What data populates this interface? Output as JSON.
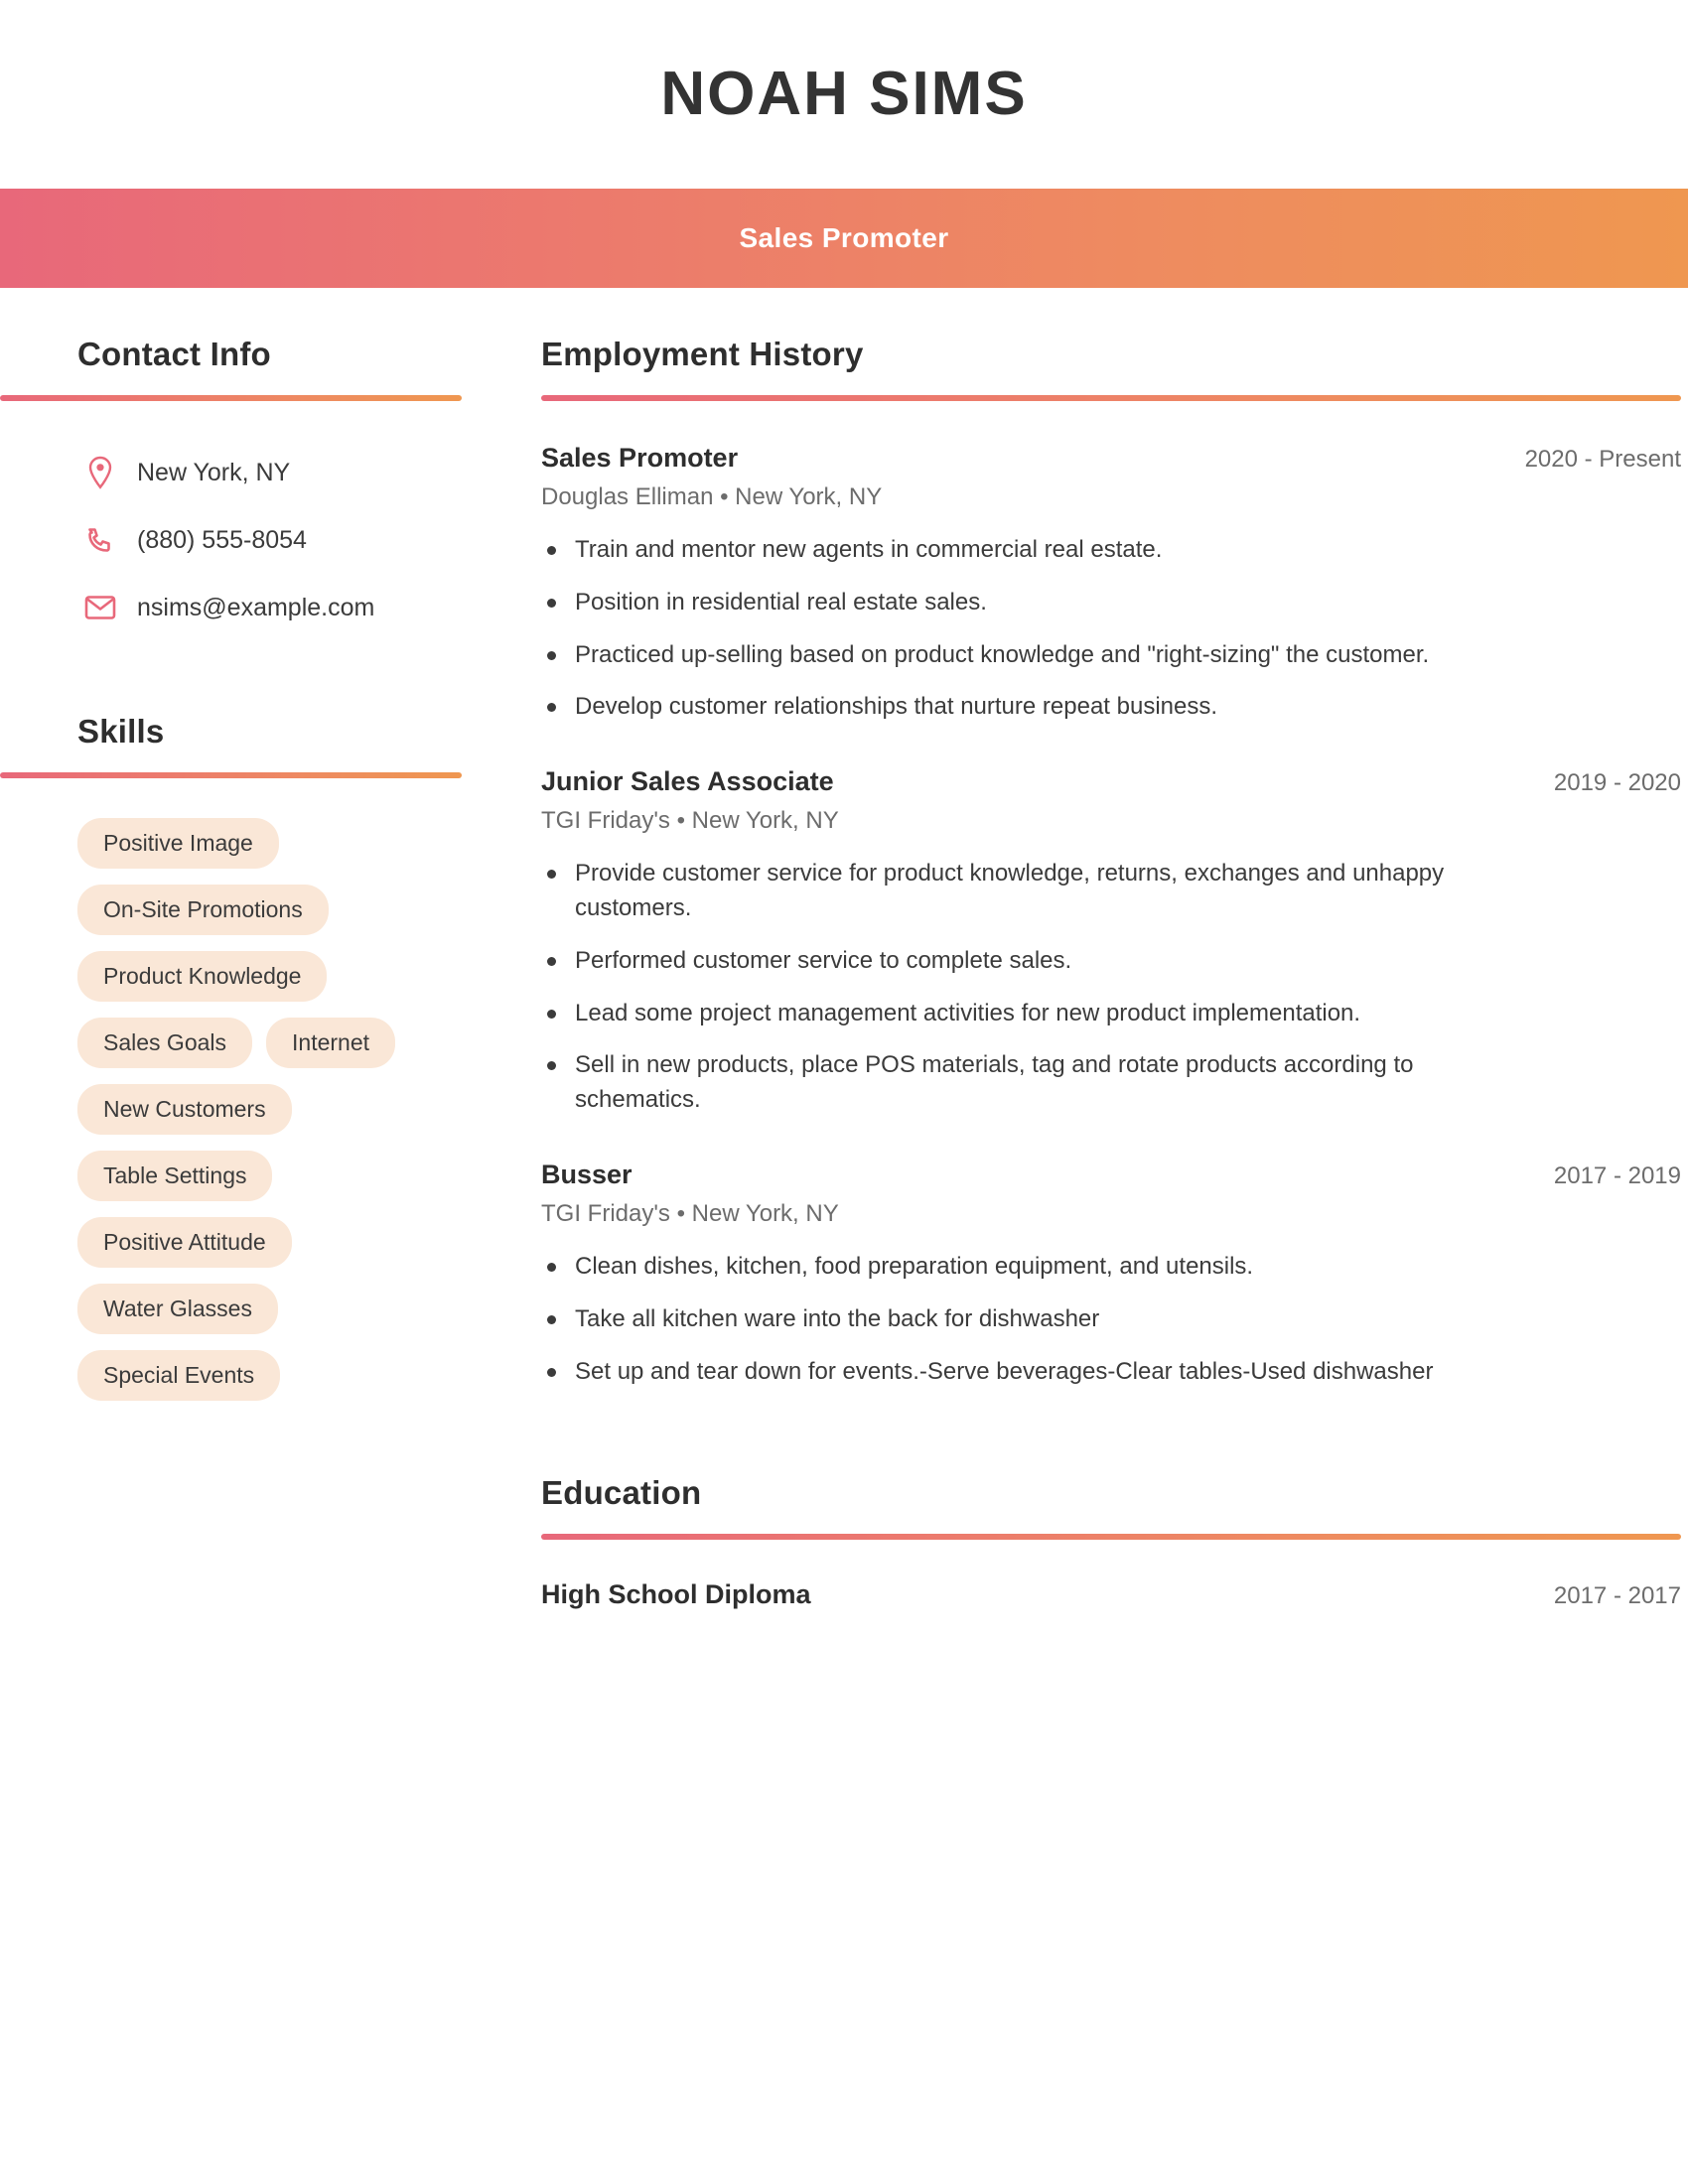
{
  "header": {
    "full_name": "NOAH SIMS",
    "job_title": "Sales Promoter",
    "band_gradient_start": "#E8687A",
    "band_gradient_end": "#EF9750"
  },
  "sidebar": {
    "contact": {
      "heading": "Contact Info",
      "items": [
        {
          "icon": "location-pin-icon",
          "value": "New York, NY"
        },
        {
          "icon": "phone-icon",
          "value": "(880) 555-8054"
        },
        {
          "icon": "envelope-icon",
          "value": "nsims@example.com"
        }
      ]
    },
    "skills": {
      "heading": "Skills",
      "tag_background": "#FAE7D7",
      "items": [
        "Positive Image",
        "On-Site Promotions",
        "Product Knowledge",
        "Sales Goals",
        "Internet",
        "New Customers",
        "Table Settings",
        "Positive Attitude",
        "Water Glasses",
        "Special Events"
      ]
    }
  },
  "main": {
    "employment": {
      "heading": "Employment History",
      "jobs": [
        {
          "role": "Sales Promoter",
          "dates": "2020 - Present",
          "meta": "Douglas Elliman  •  New York, NY",
          "bullets": [
            "Train and mentor new agents in commercial real estate.",
            "Position in residential real estate sales.",
            "Practiced up-selling based on product knowledge and \"right-sizing\" the customer.",
            "Develop customer relationships that nurture repeat business."
          ]
        },
        {
          "role": "Junior Sales Associate",
          "dates": "2019 - 2020",
          "meta": "TGI Friday's  •  New York, NY",
          "bullets": [
            "Provide customer service for product knowledge, returns, exchanges and unhappy customers.",
            "Performed customer service to complete sales.",
            "Lead some project management activities for new product implementation.",
            "Sell in new products, place POS materials, tag and rotate products according to schematics."
          ]
        },
        {
          "role": "Busser",
          "dates": "2017 - 2019",
          "meta": "TGI Friday's  •  New York, NY",
          "bullets": [
            "Clean dishes, kitchen, food preparation equipment, and utensils.",
            "Take all kitchen ware into the back for dishwasher",
            "Set up and tear down for events.-Serve beverages-Clear tables-Used dishwasher"
          ]
        }
      ]
    },
    "education": {
      "heading": "Education",
      "entries": [
        {
          "degree": "High School Diploma",
          "dates": "2017 - 2017"
        }
      ]
    }
  }
}
